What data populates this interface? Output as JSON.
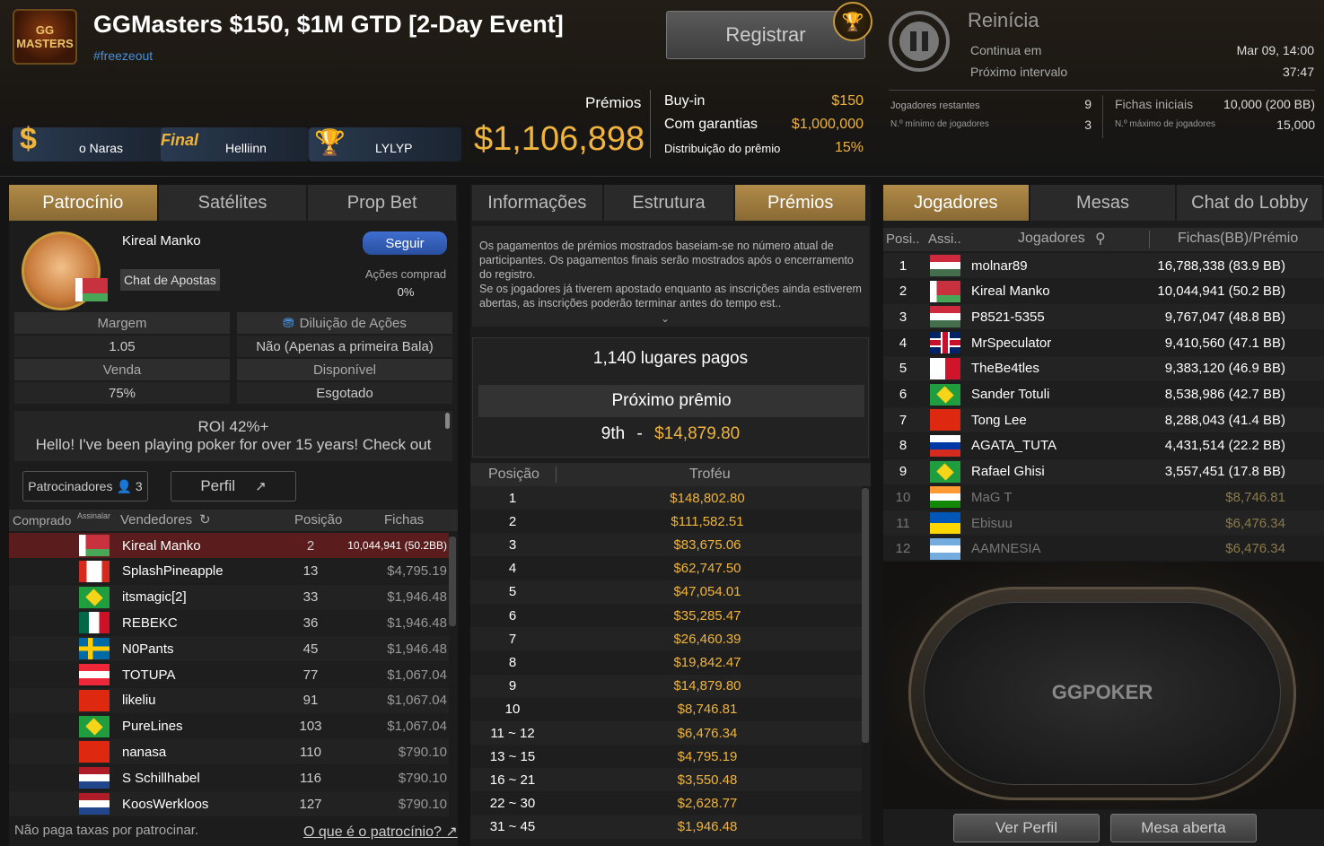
{
  "header": {
    "logo_text": "GG MASTERS",
    "title": "GGMasters $150, $1M GTD [2-Day Event]",
    "tag": "#freezeout",
    "register_button": "Registrar",
    "badges": [
      {
        "icon": "dollar-icon",
        "label": "o Naras"
      },
      {
        "icon": "final-icon",
        "label": "Final",
        "name": "Helliinn"
      },
      {
        "icon": "trophy-icon",
        "label": "LYLYP"
      }
    ],
    "prizes_label": "Prémios",
    "prizes_value": "$1,106,898",
    "buyin_label": "Buy-in",
    "buyin_value": "$150",
    "guarantee_label": "Com garantias",
    "guarantee_value": "$1,000,000",
    "distribution_label": "Distribuição do prêmio",
    "distribution_value": "15%",
    "status_title": "Reinícia",
    "continues_label": "Continua em",
    "continues_value": "Mar 09, 14:00",
    "next_break_label": "Próximo intervalo",
    "next_break_value": "37:47",
    "players_left_label": "Jogadores restantes",
    "players_left_value": "9",
    "min_players_label": "N.º mínimo de jogadores",
    "min_players_value": "3",
    "starting_chips_label": "Fichas iniciais",
    "starting_chips_value": "10,000 (200 BB)",
    "max_players_label": "N.º máximo de jogadores",
    "max_players_value": "15,000"
  },
  "left": {
    "tabs": [
      "Patrocínio",
      "Satélites",
      "Prop Bet"
    ],
    "player_name": "Kireal Manko",
    "follow_button": "Seguir",
    "chat_button": "Chat de Apostas",
    "shares_label": "Ações comprad",
    "shares_value": "0%",
    "markup_label": "Margem",
    "markup_value": "1.05",
    "dilution_label": "Diluição de Ações",
    "dilution_value": "Não (Apenas a primeira Bala)",
    "sale_label": "Venda",
    "sale_value": "75%",
    "available_label": "Disponível",
    "available_value": "Esgotado",
    "bio_line1": "ROI 42%+",
    "bio_line2": "Hello! I've been playing poker for over 15 years! Check out",
    "sponsors_button": "Patrocinadores",
    "sponsors_count": "3",
    "profile_button": "Perfil",
    "cols": [
      "Comprado",
      "Assinalar",
      "Vendedores",
      "Posição",
      "Fichas"
    ],
    "rows": [
      {
        "flag": "f-by",
        "name": "Kireal Manko",
        "pos": "2",
        "val": "10,044,941 (50.2BB)"
      },
      {
        "flag": "f-ca",
        "name": "SplashPineapple",
        "pos": "13",
        "val": "$4,795.19"
      },
      {
        "flag": "f-br",
        "name": "itsmagic[2]",
        "pos": "33",
        "val": "$1,946.48"
      },
      {
        "flag": "f-mx",
        "name": "REBEKC",
        "pos": "36",
        "val": "$1,946.48"
      },
      {
        "flag": "f-se",
        "name": "N0Pants",
        "pos": "45",
        "val": "$1,946.48"
      },
      {
        "flag": "f-at",
        "name": "TOTUPA",
        "pos": "77",
        "val": "$1,067.04"
      },
      {
        "flag": "f-cn",
        "name": "likeliu",
        "pos": "91",
        "val": "$1,067.04"
      },
      {
        "flag": "f-br",
        "name": "PureLines",
        "pos": "103",
        "val": "$1,067.04"
      },
      {
        "flag": "f-cn",
        "name": "nanasa",
        "pos": "110",
        "val": "$790.10"
      },
      {
        "flag": "f-nl",
        "name": "S Schillhabel",
        "pos": "116",
        "val": "$790.10"
      },
      {
        "flag": "f-nl",
        "name": "KoosWerkloos",
        "pos": "127",
        "val": "$790.10"
      }
    ],
    "footer_note": "Não paga taxas por patrocinar.",
    "footer_link": "O que é o patrocínio?"
  },
  "middle": {
    "tabs": [
      "Informações",
      "Estrutura",
      "Prémios"
    ],
    "info_text": "Os pagamentos de prémios mostrados baseiam-se no número atual de participantes. Os pagamentos finais serão mostrados após o encerramento do registro.\nSe os jogadores já tiverem apostado enquanto as inscrições ainda estiverem abertas, as inscrições poderão terminar antes do tempo est..",
    "paid_places": "1,140 lugares pagos",
    "next_prize_label": "Próximo prêmio",
    "next_prize_place": "9th",
    "next_prize_sep": "-",
    "next_prize_value": "$14,879.80",
    "cols": [
      "Posição",
      "Troféu"
    ],
    "rows": [
      {
        "pos": "1",
        "val": "$148,802.80"
      },
      {
        "pos": "2",
        "val": "$111,582.51"
      },
      {
        "pos": "3",
        "val": "$83,675.06"
      },
      {
        "pos": "4",
        "val": "$62,747.50"
      },
      {
        "pos": "5",
        "val": "$47,054.01"
      },
      {
        "pos": "6",
        "val": "$35,285.47"
      },
      {
        "pos": "7",
        "val": "$26,460.39"
      },
      {
        "pos": "8",
        "val": "$19,842.47"
      },
      {
        "pos": "9",
        "val": "$14,879.80"
      },
      {
        "pos": "10",
        "val": "$8,746.81"
      },
      {
        "pos": "11 ~ 12",
        "val": "$6,476.34"
      },
      {
        "pos": "13 ~ 15",
        "val": "$4,795.19"
      },
      {
        "pos": "16 ~ 21",
        "val": "$3,550.48"
      },
      {
        "pos": "22 ~ 30",
        "val": "$2,628.77"
      },
      {
        "pos": "31 ~ 45",
        "val": "$1,946.48"
      }
    ]
  },
  "right": {
    "tabs": [
      "Jogadores",
      "Mesas",
      "Chat do Lobby"
    ],
    "cols": [
      "Posi..",
      "Assi..",
      "Jogadores",
      "Fichas(BB)/Prémio"
    ],
    "rows": [
      {
        "pos": "1",
        "flag": "f-hu",
        "name": "molnar89",
        "val": "16,788,338 (83.9 BB)",
        "out": false
      },
      {
        "pos": "2",
        "flag": "f-by",
        "name": "Kireal Manko",
        "val": "10,044,941 (50.2 BB)",
        "out": false
      },
      {
        "pos": "3",
        "flag": "f-hu",
        "name": "P8521-5355",
        "val": "9,767,047 (48.8 BB)",
        "out": false
      },
      {
        "pos": "4",
        "flag": "f-gb",
        "name": "MrSpeculator",
        "val": "9,410,560 (47.1 BB)",
        "out": false
      },
      {
        "pos": "5",
        "flag": "f-mt",
        "name": "TheBe4tles",
        "val": "9,383,120 (46.9 BB)",
        "out": false
      },
      {
        "pos": "6",
        "flag": "f-br",
        "name": "Sander Totuli",
        "val": "8,538,986 (42.7 BB)",
        "out": false
      },
      {
        "pos": "7",
        "flag": "f-cn",
        "name": "Tong Lee",
        "val": "8,288,043 (41.4 BB)",
        "out": false
      },
      {
        "pos": "8",
        "flag": "f-ru",
        "name": "AGATA_TUTA",
        "val": "4,431,514 (22.2 BB)",
        "out": false
      },
      {
        "pos": "9",
        "flag": "f-br",
        "name": "Rafael Ghisi",
        "val": "3,557,451 (17.8 BB)",
        "out": false
      },
      {
        "pos": "10",
        "flag": "f-in",
        "name": "MaG T",
        "val": "$8,746.81",
        "out": true
      },
      {
        "pos": "11",
        "flag": "f-ua",
        "name": "Ebisuu",
        "val": "$6,476.34",
        "out": true
      },
      {
        "pos": "12",
        "flag": "f-ar",
        "name": "AAMNESIA",
        "val": "$6,476.34",
        "out": true
      }
    ],
    "table_logo": "GGPOKER",
    "view_profile_button": "Ver Perfil",
    "open_table_button": "Mesa aberta"
  }
}
